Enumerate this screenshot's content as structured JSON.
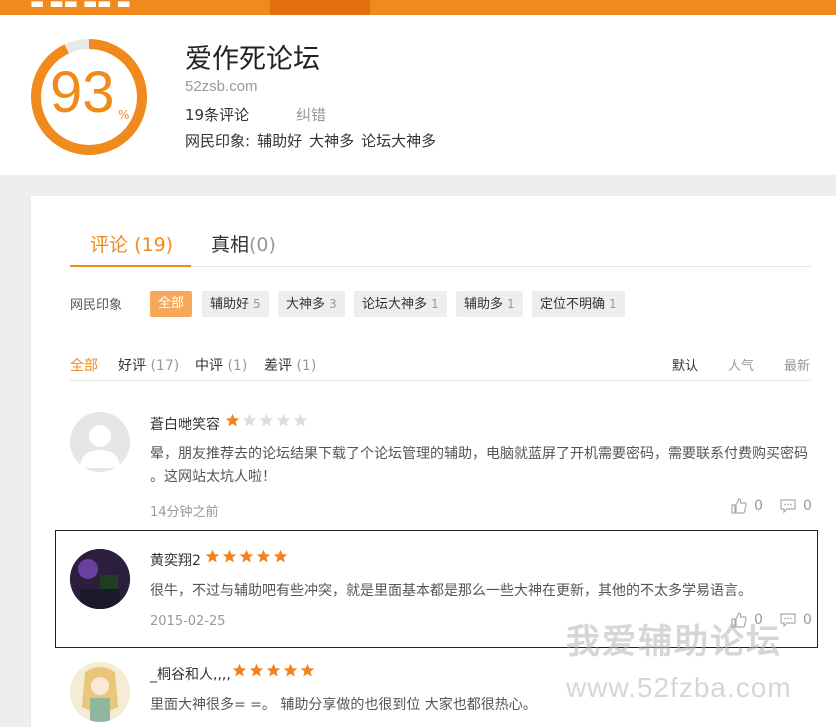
{
  "topbar": {
    "fragment": "▬ ▬▬ ▬▬ ▬"
  },
  "site": {
    "score": "93",
    "score_unit": "%",
    "title": "爱作死论坛",
    "url": "52zsb.com",
    "review_count": "19条评论",
    "correct_label": "纠错",
    "impression_label": "网民印象:",
    "impressions": [
      "辅助好",
      "大神多",
      "论坛大神多"
    ]
  },
  "tabs": {
    "reviews_label": "评论",
    "reviews_count": "(19)",
    "truth_label": "真相",
    "truth_count": "(0)"
  },
  "impression_tags": {
    "label": "网民印象",
    "items": [
      {
        "label": "全部",
        "count": ""
      },
      {
        "label": "辅助好",
        "count": "5"
      },
      {
        "label": "大神多",
        "count": "3"
      },
      {
        "label": "论坛大神多",
        "count": "1"
      },
      {
        "label": "辅助多",
        "count": "1"
      },
      {
        "label": "定位不明确",
        "count": "1"
      }
    ]
  },
  "filters": {
    "all": "全部",
    "good": "好评",
    "good_count": "(17)",
    "mid": "中评",
    "mid_count": "(1)",
    "bad": "差评",
    "bad_count": "(1)",
    "sort_default": "默认",
    "sort_popular": "人气",
    "sort_latest": "最新"
  },
  "reviews": [
    {
      "user": "蒼白哋笑容",
      "rating": 1,
      "text_line1": "晕，朋友推荐去的论坛结果下载了个论坛管理的辅助，电脑就蓝屏了开机需要密码，需要联系付费购买密码",
      "text_line2": "。这网站太坑人啦！",
      "time": "14分钟之前",
      "likes": "0",
      "replies": "0"
    },
    {
      "user": "黄奕翔2",
      "rating": 5,
      "text_line1": "很牛，不过与辅助吧有些冲突，就是里面基本都是那么一些大神在更新，其他的不太多学易语言。",
      "time": "2015-02-25",
      "likes": "0",
      "replies": "0"
    },
    {
      "user": "_桐谷和人,,,,",
      "rating": 5,
      "text_line1": "里面大神很多= =。 辅助分享做的也很到位 大家也都很热心。"
    }
  ],
  "watermark": {
    "line1": "我爱辅助论坛",
    "line2": "www.52fzba.com"
  },
  "colors": {
    "accent": "#f08a1c",
    "star_on": "#f5821f",
    "star_off": "#dddddd"
  }
}
